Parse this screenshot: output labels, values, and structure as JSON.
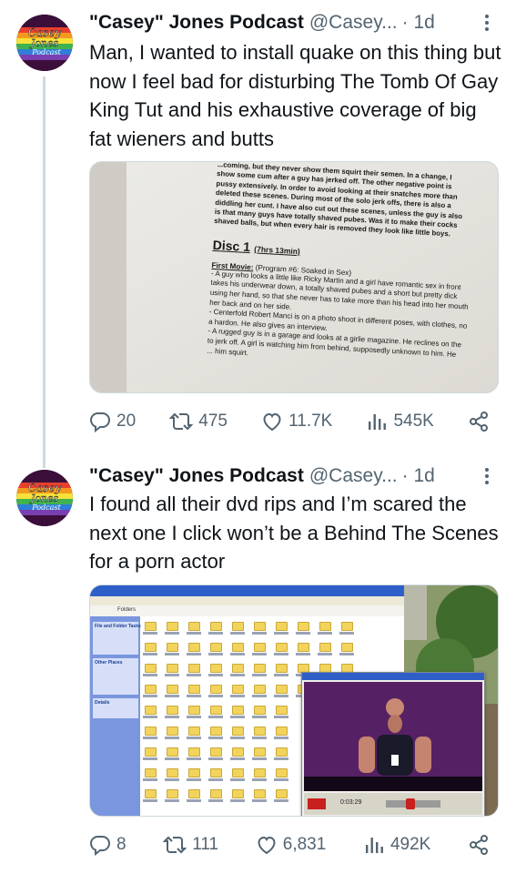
{
  "tweets": [
    {
      "author": "\"Casey\" Jones Podcast",
      "handle": "@Casey...",
      "time": "· 1d",
      "avatar_text": [
        "Casey",
        "Jones",
        "Podcast"
      ],
      "text": "Man, I wanted to install quake on this thing but now I feel bad for disturbing The Tomb Of Gay King Tut and his exhaustive coverage of big fat wieners and butts",
      "media": {
        "type": "photo-of-document",
        "lines_top": [
          "...coming, but they never show them squirt their semen. In a change, I",
          "show some cum after a guy has jerked off. The other negative point is",
          "pussy extensively. In order to avoid looking at their snatches more than",
          "deleted these scenes. During most of the solo jerk offs, there is also a",
          "diddling her cunt. I have also cut out these scenes, unless the guy is also",
          "is that many guys have totally shaved pubes. Was it to make their cocks",
          "shaved balls, but when every hair is removed they look like little boys."
        ],
        "disc_heading": "Disc 1",
        "disc_runtime": "(7hrs 13min)",
        "movie_label": "First Movie:",
        "movie_title": "(Program #6: Soaked in Sex)",
        "lines_bottom": [
          "- A guy who looks a little like Ricky Martin and a girl have romantic sex in front",
          "takes his underwear down, a totally shaved pubes and a short but pretty dick",
          "using her hand, so that she never has to take more than his head into her mouth",
          "her back and on her side.",
          "- Centerfold Robert Manci is on a photo shoot in different poses, with clothes, no",
          "a hardon. He also gives an interview.",
          "- A rugged guy is in a garage and looks at a girlie magazine. He reclines on the",
          "to jerk off. A girl is watching him from behind, supposedly unknown to him. He",
          "... him squirt."
        ]
      },
      "stats": {
        "replies": "20",
        "reposts": "475",
        "likes": "11.7K",
        "views": "545K"
      }
    },
    {
      "author": "\"Casey\" Jones Podcast",
      "handle": "@Casey...",
      "time": "· 1d",
      "avatar_text": [
        "Casey",
        "Jones",
        "Podcast"
      ],
      "text": "I found all their dvd rips and I’m scared the next one I click won’t be a Behind The Scenes for a porn actor",
      "media": {
        "type": "photo-of-monitor",
        "window_title": "Folders",
        "pane_headings": [
          "File and Folder Tasks",
          "Other Places",
          "Details"
        ],
        "player_counter": "0:03:29"
      },
      "stats": {
        "replies": "8",
        "reposts": "111",
        "likes": "6,831",
        "views": "492K"
      }
    }
  ],
  "colors": {
    "text": "#0f1419",
    "secondary": "#536471",
    "border": "#cfd9de"
  },
  "icons": [
    "reply-icon",
    "repost-icon",
    "like-icon",
    "views-icon",
    "share-icon",
    "more-icon"
  ]
}
